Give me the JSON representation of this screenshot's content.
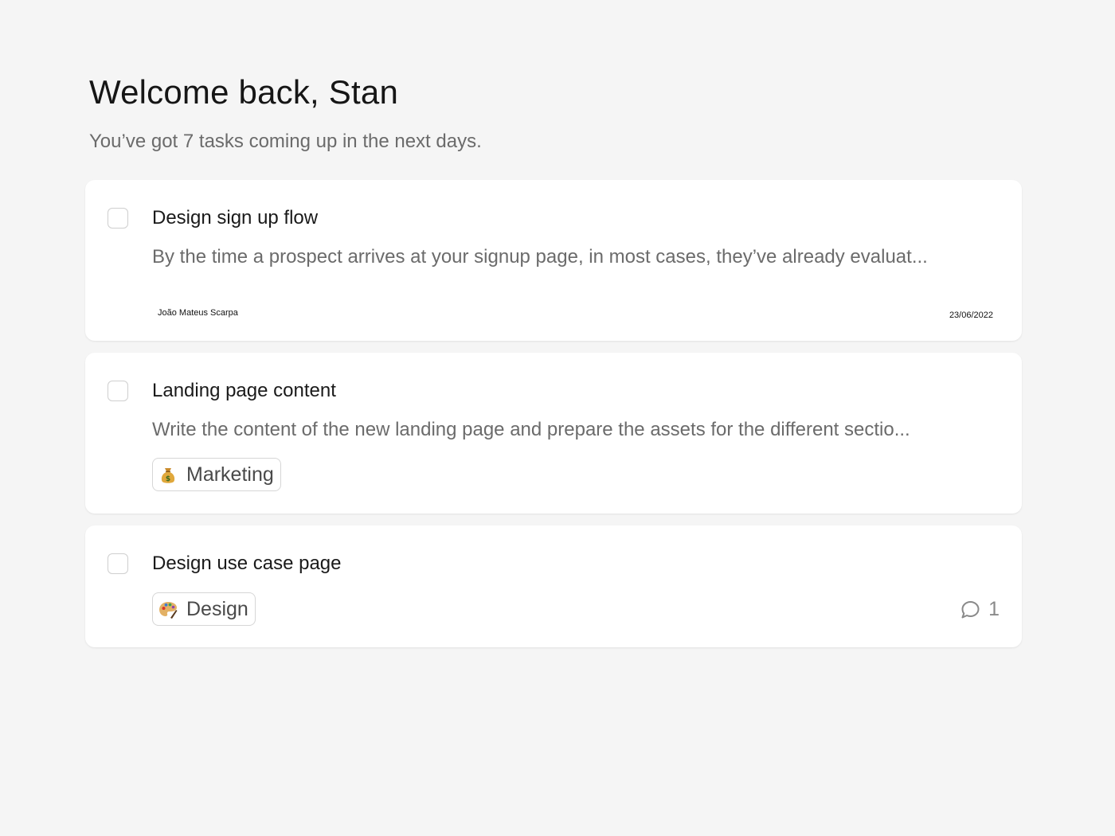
{
  "header": {
    "title": "Welcome back, Stan",
    "subtitle": "You’ve got 7 tasks coming up in the next days."
  },
  "tasks": [
    {
      "title": "Design sign up flow",
      "description": "By the time a prospect arrives at your signup page, in most cases, they’ve already evaluat...",
      "author": "João Mateus Scarpa",
      "date": "23/06/2022",
      "completed": false
    },
    {
      "title": "Landing page content",
      "description": "Write the content of the new landing page and prepare the assets for the different sectio...",
      "tag": {
        "label": "Marketing",
        "icon": "money-bag-icon"
      },
      "completed": false
    },
    {
      "title": "Design use case page",
      "tag": {
        "label": "Design",
        "icon": "artist-palette-icon"
      },
      "comments": {
        "count": "1",
        "icon": "comment-icon"
      },
      "completed": false
    }
  ],
  "colors": {
    "background": "#f5f5f5",
    "card": "#ffffff",
    "title_text": "#161616",
    "muted_text": "#6b6b6b",
    "checkbox_border": "#cfcfcf",
    "tag_border": "#d6d6d6"
  }
}
